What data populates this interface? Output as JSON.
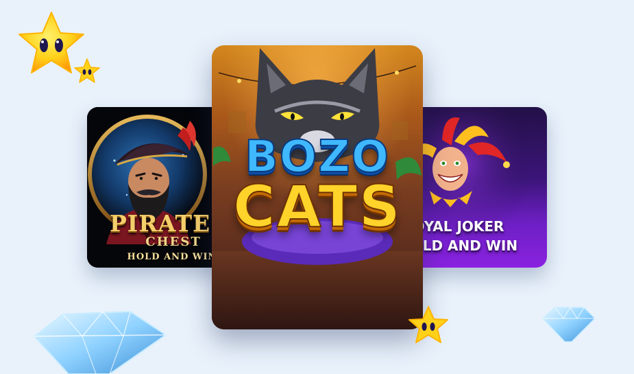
{
  "games": [
    {
      "title_line1": "PIRATES",
      "title_line2": "CHEST",
      "title_line3": "HOLD AND WIN"
    },
    {
      "title_line1": "BOZO",
      "title_line2": "CATS"
    },
    {
      "title_line1": "ROYAL JOKER",
      "title_line2": "HOLD AND WIN"
    }
  ],
  "colors": {
    "background": "#e9f2fb",
    "bozo_blue": "#3fb8ff",
    "cats_yellow": "#ffd32a",
    "joker_purple": "#8a22e0",
    "star_gold": "#ffd21a"
  },
  "icons": [
    "star-icon",
    "diamond-icon"
  ]
}
